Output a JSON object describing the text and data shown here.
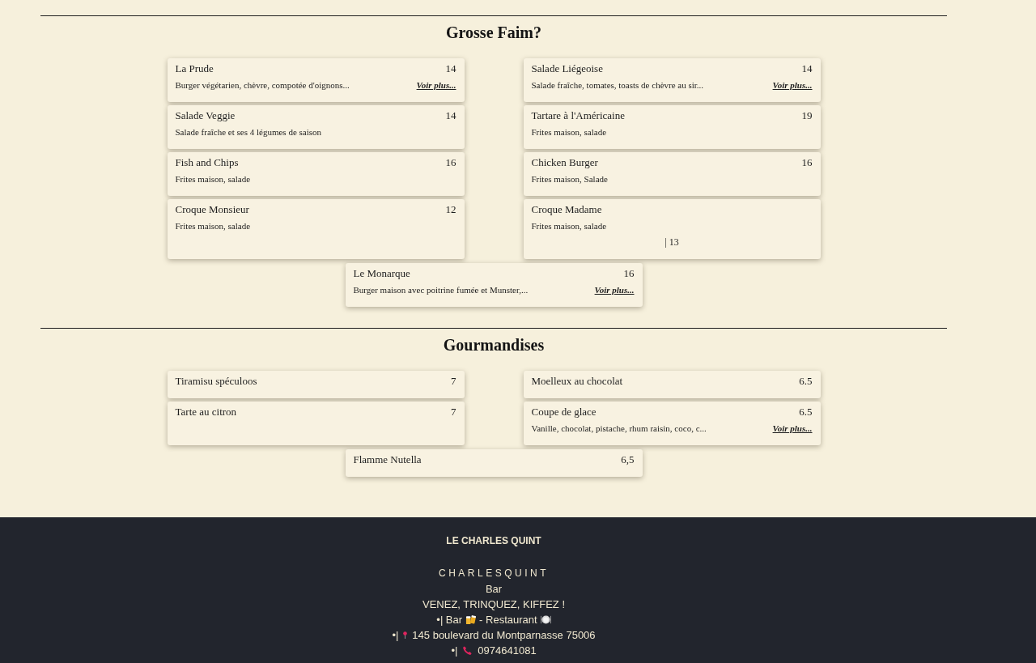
{
  "sections": [
    {
      "title": "Grosse Faim?",
      "items": [
        {
          "kind": "standard",
          "name": "La Prude",
          "price": "14",
          "description": "Burger végétarien, chèvre, compotée d'oignons...",
          "more_link": "Voir plus..."
        },
        {
          "kind": "standard",
          "name": "Salade Liégeoise",
          "price": "14",
          "description": "Salade fraîche, tomates, toasts de chèvre au sir...",
          "more_link": "Voir plus..."
        },
        {
          "kind": "standard",
          "name": "Salade Veggie",
          "price": "14",
          "description": "Salade fraîche et ses 4 légumes de saison"
        },
        {
          "kind": "standard",
          "name": "Tartare à l'Américaine",
          "price": "19",
          "description": "Frites maison, salade"
        },
        {
          "kind": "standard",
          "name": "Fish and Chips",
          "price": "16",
          "description": "Frites maison, salade"
        },
        {
          "kind": "standard",
          "name": "Chicken Burger",
          "price": "16",
          "description": "Frites maison, Salade"
        },
        {
          "kind": "standard",
          "name": "Croque Monsieur",
          "price": "12",
          "description": "Frites maison, salade"
        },
        {
          "kind": "price_below",
          "name": "Croque Madame",
          "price": "| 13",
          "description": "Frites maison, salade"
        },
        {
          "kind": "standard",
          "name": "Le Monarque",
          "price": "16",
          "description": "Burger maison avec poitrine fumée et Munster,...",
          "more_link": "Voir plus..."
        }
      ]
    },
    {
      "title": "Gourmandises",
      "items": [
        {
          "kind": "standard",
          "name": "Tiramisu spéculoos",
          "price": "7"
        },
        {
          "kind": "standard",
          "name": "Moelleux au chocolat",
          "price": "6.5"
        },
        {
          "kind": "standard",
          "name": "Tarte au citron",
          "price": "7"
        },
        {
          "kind": "standard",
          "name": "Coupe de glace",
          "price": "6.5",
          "description": "Vanille, chocolat, pistache, rhum raisin, coco, c...",
          "more_link": "Voir plus..."
        },
        {
          "kind": "standard",
          "name": "Flamme Nutella",
          "price": "6,5"
        }
      ]
    }
  ],
  "footer": {
    "title": "LE CHARLES QUINT",
    "brand": "CHARLESQUINT",
    "lines": [
      {
        "kind": "plain",
        "parts": [
          "Bar"
        ]
      },
      {
        "kind": "plain",
        "parts": [
          "VENEZ, TRINQUEZ, KIFFEZ !"
        ]
      },
      {
        "kind": "services",
        "parts": [
          "•| Bar",
          "- Restaurant"
        ]
      },
      {
        "kind": "address",
        "parts": [
          "•|",
          "145 boulevard du Montparnasse 75006"
        ]
      },
      {
        "kind": "phone",
        "parts": [
          "•|",
          "0974641081"
        ]
      }
    ]
  }
}
